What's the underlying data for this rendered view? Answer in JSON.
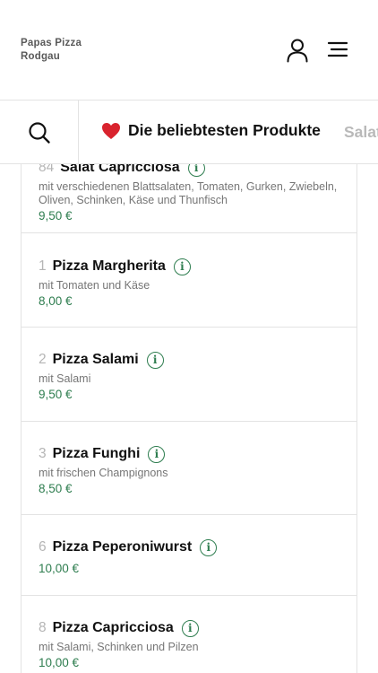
{
  "header": {
    "brand_line1": "Papas Pizza",
    "brand_line2": "Rodgau",
    "user_icon": "user-icon",
    "menu_icon": "hamburger-menu-icon"
  },
  "categories": {
    "search_icon": "search-icon",
    "active_label": "Die beliebtesten Produkte",
    "active_emoji": "heart-icon",
    "next_label": "Salate"
  },
  "colors": {
    "accent_green": "#2e7d4f",
    "heart_red": "#d9232e",
    "muted_text": "#767676",
    "divider": "#e3e3e3"
  },
  "products": [
    {
      "number": "84",
      "name": "Salat Capricciosa",
      "description": "mit verschiedenen Blattsalaten, Tomaten, Gurken, Zwiebeln, Oliven, Schinken, Käse und Thunfisch",
      "price": "9,50 €"
    },
    {
      "number": "1",
      "name": "Pizza Margherita",
      "description": "mit Tomaten und Käse",
      "price": "8,00 €"
    },
    {
      "number": "2",
      "name": "Pizza Salami",
      "description": "mit Salami",
      "price": "9,50 €"
    },
    {
      "number": "3",
      "name": "Pizza Funghi",
      "description": "mit frischen Champignons",
      "price": "8,50 €"
    },
    {
      "number": "6",
      "name": "Pizza Peperoniwurst",
      "description": "",
      "price": "10,00 €"
    },
    {
      "number": "8",
      "name": "Pizza Capricciosa",
      "description": "mit Salami, Schinken und Pilzen",
      "price": "10,00 €"
    }
  ]
}
